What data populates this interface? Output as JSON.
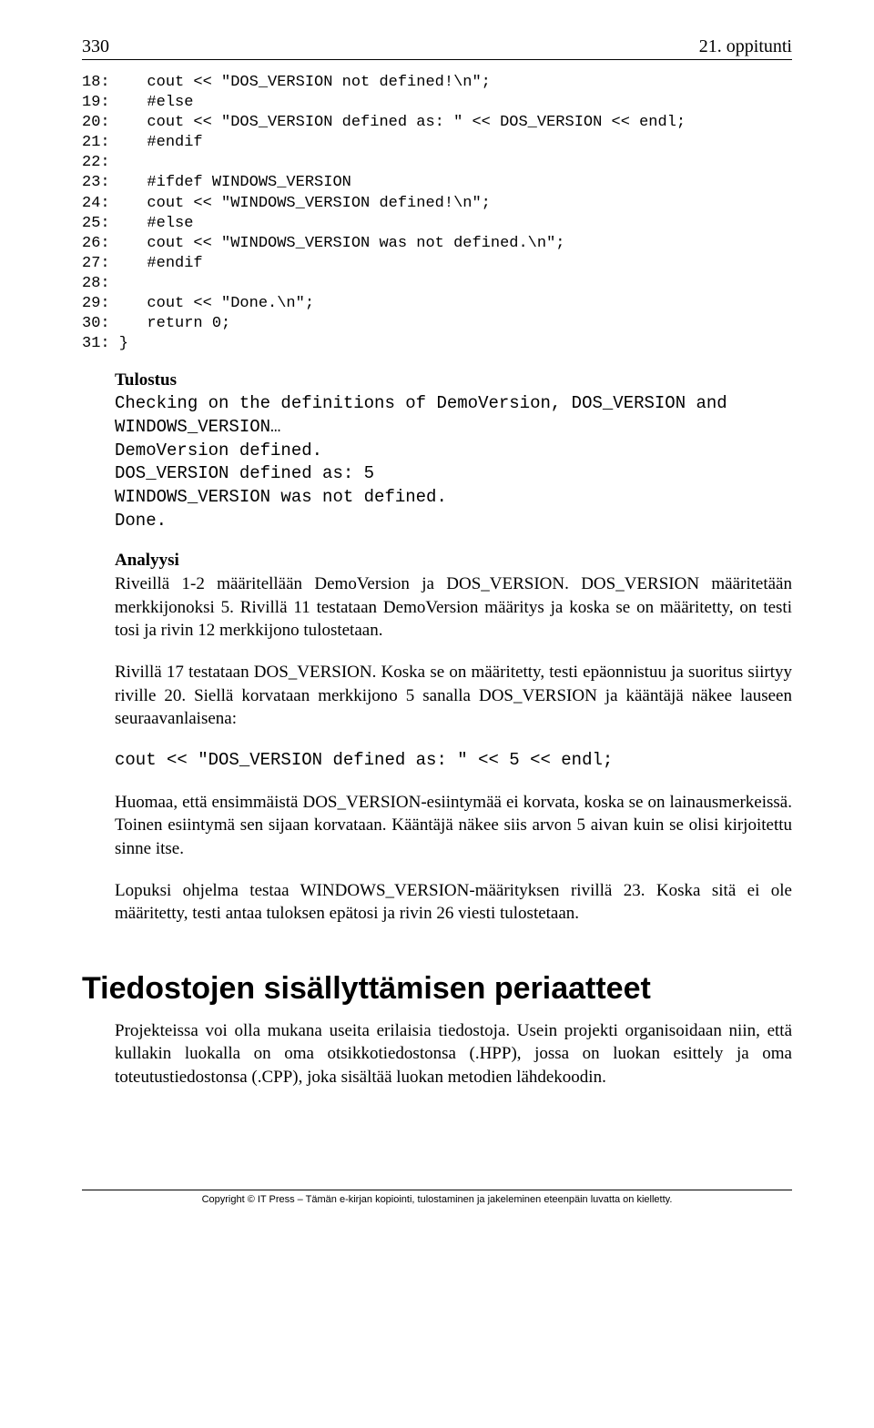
{
  "header": {
    "page_number": "330",
    "chapter": "21. oppitunti"
  },
  "code": {
    "lines": "18:    cout << \"DOS_VERSION not defined!\\n\";\n19:    #else\n20:    cout << \"DOS_VERSION defined as: \" << DOS_VERSION << endl;\n21:    #endif\n22:\n23:    #ifdef WINDOWS_VERSION\n24:    cout << \"WINDOWS_VERSION defined!\\n\";\n25:    #else\n26:    cout << \"WINDOWS_VERSION was not defined.\\n\";\n27:    #endif\n28:\n29:    cout << \"Done.\\n\";\n30:    return 0;\n31: }"
  },
  "tulostus": {
    "label": "Tulostus",
    "text": "Checking on the definitions of DemoVersion, DOS_VERSION and\nWINDOWS_VERSION…\nDemoVersion defined.\nDOS_VERSION defined as: 5\nWINDOWS_VERSION was not defined.\nDone."
  },
  "analyysi": {
    "label": "Analyysi",
    "p1": "Riveillä 1-2 määritellään DemoVersion ja DOS_VERSION. DOS_VERSION määritetään merkkijonoksi 5. Rivillä 11 testataan DemoVersion määritys ja koska se on määritetty, on testi tosi ja rivin 12 merkkijono tulostetaan.",
    "p2": "Rivillä 17 testataan DOS_VERSION. Koska se on määritetty, testi epäonnistuu ja suoritus siirtyy riville 20. Siellä korvataan merkkijono 5 sanalla DOS_VERSION ja kääntäjä näkee lauseen seuraavanlaisena:",
    "code_line": "cout << \"DOS_VERSION defined as: \" << 5 << endl;",
    "p3": "Huomaa, että ensimmäistä DOS_VERSION-esiintymää ei korvata, koska se on lainausmerkeissä. Toinen esiintymä sen sijaan korvataan. Kääntäjä näkee siis arvon 5 aivan kuin se olisi kirjoitettu sinne itse.",
    "p4": "Lopuksi ohjelma testaa WINDOWS_VERSION-määrityksen rivillä 23. Koska sitä ei ole määritetty, testi antaa tuloksen epätosi ja rivin 26 viesti tulostetaan."
  },
  "heading": "Tiedostojen sisällyttämisen periaatteet",
  "body_after_heading": "Projekteissa voi olla mukana useita erilaisia tiedostoja. Usein projekti organisoidaan niin, että kullakin luokalla on oma otsikkotiedostonsa (.HPP), jossa on luokan esittely ja oma toteutustiedostonsa (.CPP), joka sisältää luokan metodien lähdekoodin.",
  "footer": "Copyright © IT Press – Tämän e-kirjan kopiointi, tulostaminen ja jakeleminen eteenpäin luvatta on kielletty."
}
